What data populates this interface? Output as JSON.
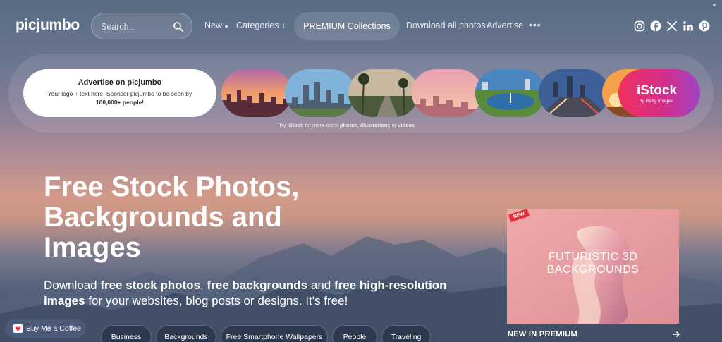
{
  "brand": {
    "logo": "picjumbo"
  },
  "search": {
    "placeholder": "Search..."
  },
  "nav": {
    "new_label": "New",
    "categories_label": "Categories",
    "premium_label": "PREMIUM Collections",
    "download_label": "Download all photos",
    "advertise_label": "Advertise",
    "more_label": "•••"
  },
  "social_icons": [
    "instagram-icon",
    "facebook-icon",
    "x-icon",
    "linkedin-icon",
    "pinterest-icon"
  ],
  "ad": {
    "title": "Advertise on picjumbo",
    "text_prefix": "Your logo + text here. Sponsor picjumbo to be seen by ",
    "text_bold": "100,000+ people!",
    "istock_logo": "iStock",
    "istock_sub": "by Getty Images",
    "try_prefix": "Try ",
    "try_brand": "iStock",
    "try_mid": " for more stock ",
    "try_photos": "photos",
    "try_sep": ", ",
    "try_illustrations": "illustrations",
    "try_or": " or ",
    "try_videos": "videos",
    "try_end": "."
  },
  "hero": {
    "title": "Free Stock Photos, Backgrounds and Images",
    "sub_1": "Download ",
    "sub_b1": "free stock photos",
    "sub_2": ", ",
    "sub_b2": "free backgrounds",
    "sub_3": " and ",
    "sub_b3": "free high-resolution images",
    "sub_4": " for your websites, blog posts or designs. It's free!"
  },
  "premium_card": {
    "badge": "NEW",
    "title": "FUTURISTIC 3D BACKGROUNDS",
    "caption": "NEW IN PREMIUM"
  },
  "chips": [
    "Business",
    "Backgrounds",
    "Free Smartphone Wallpapers",
    "People",
    "Traveling"
  ],
  "bmc": {
    "label": "Buy Me a Coffee"
  },
  "colors": {
    "istock_start": "#f0305e",
    "istock_end": "#9f43c3",
    "badge": "#e8303b"
  }
}
